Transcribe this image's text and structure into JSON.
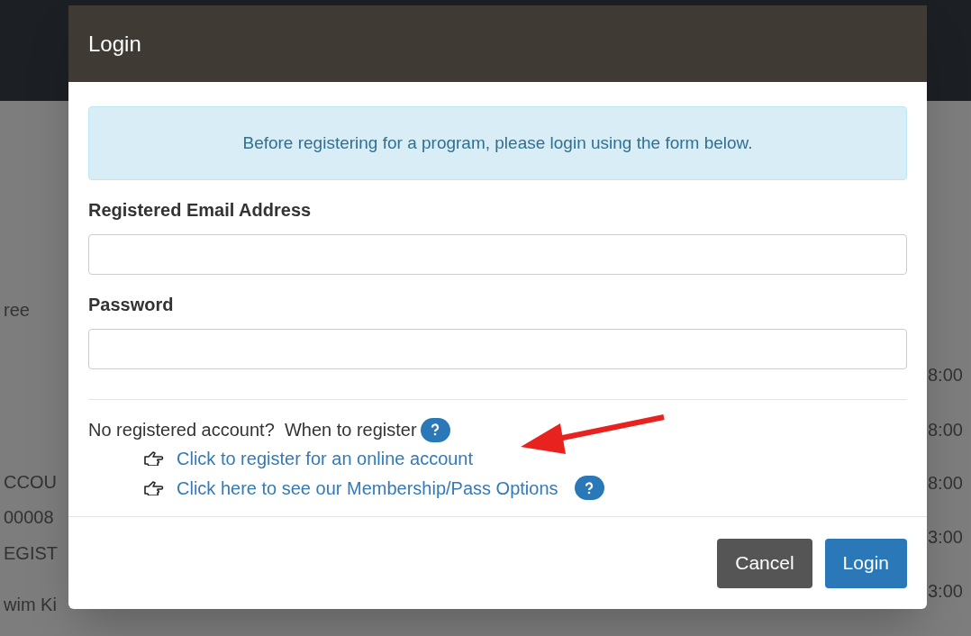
{
  "background": {
    "left_texts": [
      "ree",
      "CCOU",
      "00008",
      "EGIST",
      "wim Ki"
    ],
    "right_texts": [
      "8:00",
      "8:00",
      "8:00",
      "3:00",
      "3:00"
    ]
  },
  "dialog": {
    "title": "Login",
    "notice": "Before registering for a program, please login using the form below.",
    "fields": [
      {
        "label": "Registered Email Address"
      },
      {
        "label": "Password"
      }
    ],
    "register_prompt": "No registered account?  When to register",
    "links": [
      {
        "text": "Click to register for an online account",
        "help": false
      },
      {
        "text": "Click here to see our Membership/Pass Options",
        "help": true
      }
    ],
    "buttons": [
      {
        "label": "Cancel",
        "kind": "secondary"
      },
      {
        "label": "Login",
        "kind": "primary"
      }
    ]
  }
}
